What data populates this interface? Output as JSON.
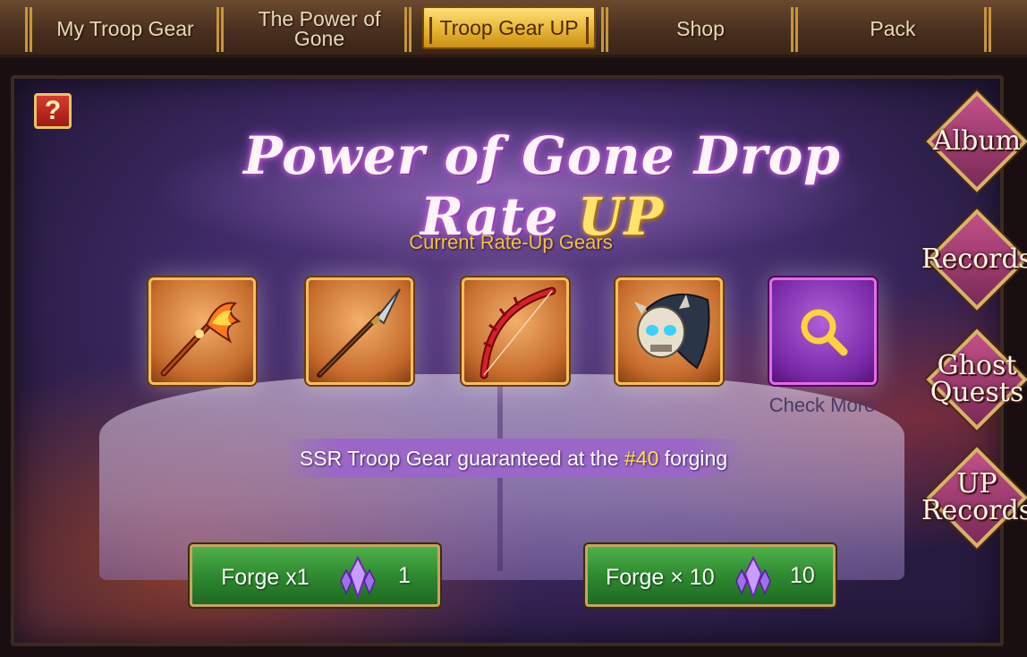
{
  "tabs": [
    {
      "label": "My Troop Gear"
    },
    {
      "label": "The Power of Gone"
    },
    {
      "label": "Troop Gear UP"
    },
    {
      "label": "Shop"
    },
    {
      "label": "Pack"
    }
  ],
  "active_tab": "Troop Gear UP",
  "help_button": {
    "label": "?"
  },
  "banner": {
    "title_main": "Power of Gone  Drop Rate ",
    "title_up": "UP"
  },
  "rate_up": {
    "heading": "Current Rate-Up Gears",
    "gears": [
      {
        "icon": "flame-halberd-icon"
      },
      {
        "icon": "spear-icon"
      },
      {
        "icon": "red-bow-icon"
      },
      {
        "icon": "skull-shoulder-armor-icon"
      }
    ],
    "check_more_label": "Check More"
  },
  "guarantee": {
    "prefix": "SSR Troop Gear guaranteed at the ",
    "number": "#40",
    "suffix": " forging"
  },
  "forge": {
    "single": {
      "label": "Forge x1",
      "cost": "1"
    },
    "ten": {
      "label": "Forge × 10",
      "cost": "10"
    }
  },
  "side_buttons": [
    {
      "label": "Album"
    },
    {
      "label": "Records"
    },
    {
      "label": "Ghost Quests"
    },
    {
      "label": "UP Records"
    }
  ],
  "colors": {
    "accent_gold": "#f0c23a",
    "forge_green": "#2f8a30",
    "active_tab": "#e8b532",
    "side_button": "#a23a70"
  }
}
